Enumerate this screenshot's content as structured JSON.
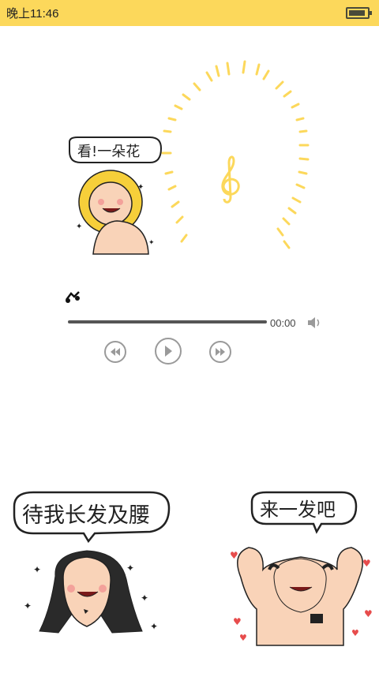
{
  "status_bar": {
    "time": "晚上11:46",
    "battery_level": 0.9
  },
  "player": {
    "cover_bubble_text": "看!一朵花",
    "elapsed": "00:00",
    "progress": 0.0,
    "icons": [
      "music-note-icon",
      "treble-clef-icon",
      "volume-icon",
      "rewind-icon",
      "play-icon",
      "fast-forward-icon"
    ]
  },
  "stickers": {
    "left_bubble_text": "待我长发及腰",
    "right_bubble_text": "来一发吧"
  },
  "colors": {
    "status_bar": "#fcd85b",
    "accent_yellow": "#fcd85b",
    "control_gray": "#9a9a9a"
  }
}
